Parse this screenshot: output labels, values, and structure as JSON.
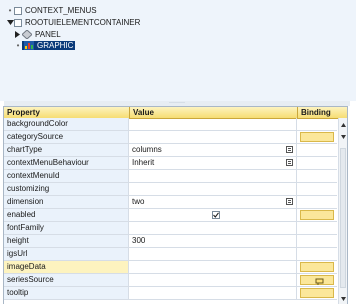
{
  "tree": {
    "nodes": [
      {
        "label": "CONTEXT_MENUS"
      },
      {
        "label": "ROOTUIELEMENTCONTAINER"
      },
      {
        "label": "PANEL"
      },
      {
        "label": "GRAPHIC"
      }
    ]
  },
  "grid": {
    "headers": {
      "property": "Property",
      "value": "Value",
      "binding": "Binding"
    },
    "rows": [
      {
        "property": "backgroundColor",
        "value": ""
      },
      {
        "property": "categorySource",
        "value": ""
      },
      {
        "property": "chartType",
        "value": "columns"
      },
      {
        "property": "contextMenuBehaviour",
        "value": "Inherit"
      },
      {
        "property": "contextMenuId",
        "value": ""
      },
      {
        "property": "customizing",
        "value": ""
      },
      {
        "property": "dimension",
        "value": "two"
      },
      {
        "property": "enabled",
        "value": ""
      },
      {
        "property": "fontFamily",
        "value": ""
      },
      {
        "property": "height",
        "value": "300"
      },
      {
        "property": "igsUrl",
        "value": ""
      },
      {
        "property": "imageData",
        "value": ""
      },
      {
        "property": "seriesSource",
        "value": ""
      },
      {
        "property": "tooltip",
        "value": ""
      }
    ],
    "enabled_checked": true
  },
  "colors": {
    "header_bg": "#f6dd73",
    "selection": "#0a3a7a",
    "binding_box": "#fbe79a",
    "property_col": "#eaf2fb"
  },
  "icons": {
    "collapsed": "triangle-right-icon",
    "expanded": "triangle-down-icon",
    "panel": "panel-diamond-icon",
    "graphic": "graphic-chart-icon",
    "value_help": "value-help-icon",
    "binding": "binding-icon"
  }
}
